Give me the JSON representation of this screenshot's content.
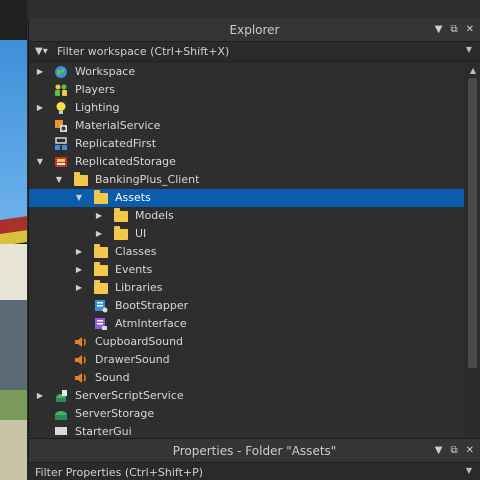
{
  "explorer": {
    "title": "Explorer",
    "filter_placeholder": "Filter workspace (Ctrl+Shift+X)",
    "items": [
      {
        "label": "Workspace",
        "icon": "workspace-globe-icon"
      },
      {
        "label": "Players",
        "icon": "players-icon"
      },
      {
        "label": "Lighting",
        "icon": "lightbulb-icon"
      },
      {
        "label": "MaterialService",
        "icon": "material-service-icon"
      },
      {
        "label": "ReplicatedFirst",
        "icon": "replicated-first-icon"
      },
      {
        "label": "ReplicatedStorage",
        "icon": "replicated-storage-icon"
      },
      {
        "label": "BankingPlus_Client",
        "icon": "folder-icon"
      },
      {
        "label": "Assets",
        "icon": "folder-icon"
      },
      {
        "label": "Models",
        "icon": "folder-icon"
      },
      {
        "label": "UI",
        "icon": "folder-icon"
      },
      {
        "label": "Classes",
        "icon": "folder-icon"
      },
      {
        "label": "Events",
        "icon": "folder-icon"
      },
      {
        "label": "Libraries",
        "icon": "folder-icon"
      },
      {
        "label": "BootStrapper",
        "icon": "local-script-icon"
      },
      {
        "label": "AtmInterface",
        "icon": "module-script-icon"
      },
      {
        "label": "CupboardSound",
        "icon": "sound-icon"
      },
      {
        "label": "DrawerSound",
        "icon": "sound-icon"
      },
      {
        "label": "Sound",
        "icon": "sound-icon"
      },
      {
        "label": "ServerScriptService",
        "icon": "server-script-service-icon"
      },
      {
        "label": "ServerStorage",
        "icon": "server-storage-icon"
      },
      {
        "label": "StarterGui",
        "icon": "starter-gui-icon"
      }
    ]
  },
  "properties": {
    "title": "Properties - Folder \"Assets\"",
    "filter_placeholder": "Filter Properties (Ctrl+Shift+P)"
  },
  "colors": {
    "selection": "#0b5cab",
    "panel_bg": "#2e2e2e",
    "header_bg": "#353535",
    "folder": "#f2c94c",
    "sound": "#e67e22"
  }
}
